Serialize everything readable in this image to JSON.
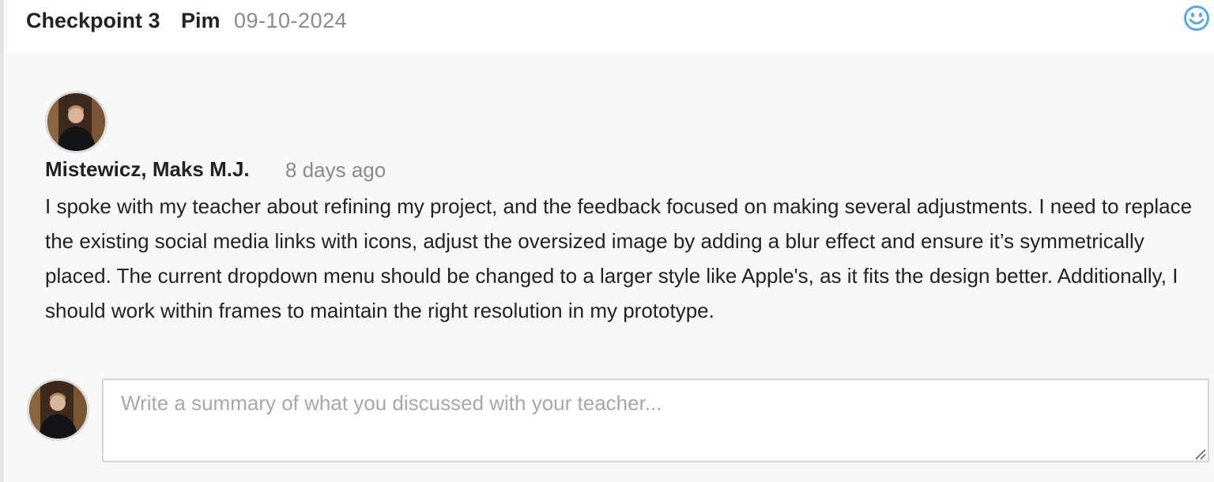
{
  "checkpoint": {
    "title": "Checkpoint 3",
    "author": "Pim",
    "date": "09-10-2024",
    "reaction_icon": "smiley-icon"
  },
  "comment": {
    "author": "Mistewicz, Maks M.J.",
    "time": "8 days ago",
    "body": "I spoke with my teacher about refining my project, and the feedback focused on making several adjustments. I need to replace the existing social media links with icons, adjust the oversized image by adding a blur effect and ensure it’s symmetrically placed. The current dropdown menu should be changed to a larger style like Apple's, as it fits the design better. Additionally, I should work within frames to maintain the right resolution in my prototype."
  },
  "summary": {
    "placeholder": "Write a summary of what you discussed with your teacher...",
    "value": ""
  },
  "colors": {
    "accent": "#5aa9e6",
    "text": "#222222",
    "muted": "#8a8a8a",
    "panel": "#f8f8f8"
  }
}
